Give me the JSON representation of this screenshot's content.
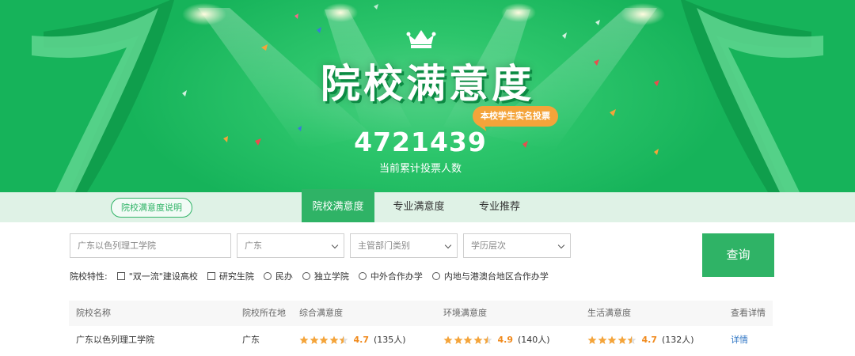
{
  "banner": {
    "title": "院校满意度",
    "vote_tag": "本校学生实名投票",
    "vote_count": "4721439",
    "vote_label": "当前累计投票人数"
  },
  "tabbar": {
    "explain_label": "院校满意度说明",
    "tabs": [
      {
        "label": "院校满意度",
        "active": true
      },
      {
        "label": "专业满意度",
        "active": false
      },
      {
        "label": "专业推荐",
        "active": false
      }
    ]
  },
  "search": {
    "school_input": "广东以色列理工学院",
    "province_select": "广东",
    "department_select": "主管部门类别",
    "level_select": "学历层次",
    "query_label": "查询"
  },
  "features": {
    "label": "院校特性:",
    "checkboxes": [
      "\"双一流\"建设高校",
      "研究生院"
    ],
    "radios": [
      "民办",
      "独立学院",
      "中外合作办学",
      "内地与港澳台地区合作办学"
    ]
  },
  "table": {
    "headers": [
      "院校名称",
      "院校所在地",
      "综合满意度",
      "环境满意度",
      "生活满意度",
      "查看详情"
    ],
    "rows": [
      {
        "name": "广东以色列理工学院",
        "location": "广东",
        "overall": {
          "score": "4.7",
          "count": "(135人)"
        },
        "environment": {
          "score": "4.9",
          "count": "(140人)"
        },
        "life": {
          "score": "4.7",
          "count": "(132人)"
        },
        "detail": "详情"
      }
    ]
  },
  "colors": {
    "brand_green": "#2fb366",
    "banner_green": "#16b35a",
    "star_orange": "#f4a43a",
    "score_orange": "#f08a1d",
    "link_blue": "#2f76c4"
  }
}
